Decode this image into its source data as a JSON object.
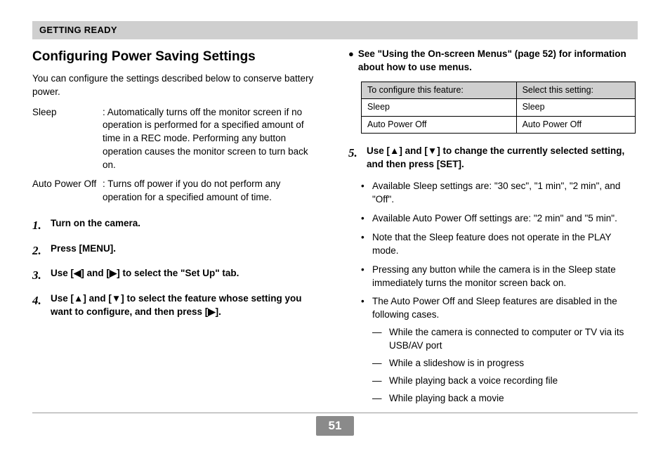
{
  "section_header": "GETTING READY",
  "left": {
    "title": "Configuring Power Saving Settings",
    "intro": "You can configure the settings described below to conserve battery power.",
    "defs": [
      {
        "term": "Sleep",
        "desc": ": Automatically turns off the monitor screen if no operation is performed for a specified amount of time in a REC mode. Performing any button operation causes the monitor screen to turn back on."
      },
      {
        "term": "Auto Power Off",
        "desc": ": Turns off power if you do not perform any operation for a specified amount of time."
      }
    ],
    "steps": [
      {
        "n": "1.",
        "body": "Turn on the camera."
      },
      {
        "n": "2.",
        "body": "Press [MENU]."
      },
      {
        "n": "3.",
        "body": "Use [◀] and [▶] to select the \"Set Up\" tab."
      },
      {
        "n": "4.",
        "body": "Use [▲] and [▼] to select the feature whose setting you want to configure, and then press [▶]."
      }
    ]
  },
  "right": {
    "lead": "See \"Using the On-screen Menus\" (page 52) for information about how to use menus.",
    "table": {
      "h1": "To configure this feature:",
      "h2": "Select this setting:",
      "rows": [
        {
          "a": "Sleep",
          "b": "Sleep"
        },
        {
          "a": "Auto Power Off",
          "b": "Auto Power Off"
        }
      ]
    },
    "step5_n": "5.",
    "step5_body": "Use [▲] and [▼] to change the currently selected setting, and then press [SET].",
    "bullets": [
      "Available Sleep settings are: \"30 sec\", \"1 min\", \"2 min\", and \"Off\".",
      "Available Auto Power Off settings are: \"2 min\" and \"5 min\".",
      "Note that the Sleep feature does not operate in the PLAY mode.",
      "Pressing any button while the camera is in the Sleep state immediately turns the monitor screen back on."
    ],
    "last_bullet": "The Auto Power Off and Sleep features are disabled in the following cases.",
    "dashes": [
      "While the camera is connected to computer or TV via its USB/AV port",
      "While a slideshow is in progress",
      "While playing back a voice recording file",
      "While playing back a movie"
    ]
  },
  "page_number": "51"
}
